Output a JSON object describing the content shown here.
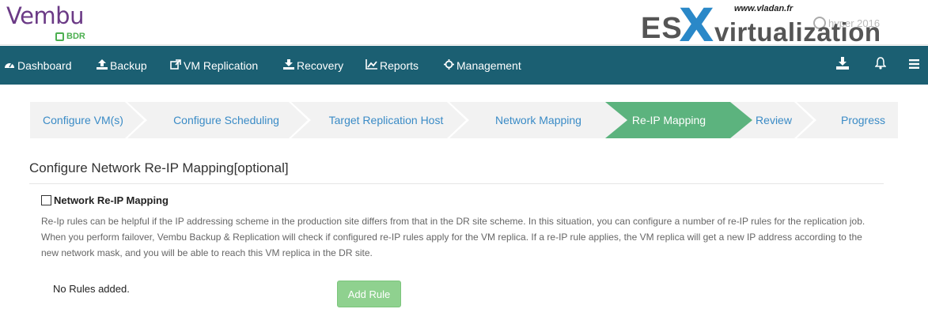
{
  "header": {
    "logo_name": "Vembu",
    "logo_sub": "BDR",
    "brand_url": "www.vladan.fr",
    "brand_es": "ES",
    "brand_x": "X",
    "brand_virt": "virtualization",
    "user_name": "hyper 2016"
  },
  "nav": {
    "items": [
      {
        "label": "Dashboard",
        "icon": "dashboard-icon"
      },
      {
        "label": "Backup",
        "icon": "upload-icon"
      },
      {
        "label": "VM Replication",
        "icon": "replication-icon"
      },
      {
        "label": "Recovery",
        "icon": "download-icon"
      },
      {
        "label": "Reports",
        "icon": "chart-icon"
      },
      {
        "label": "Management",
        "icon": "management-icon"
      }
    ],
    "right_icons": [
      "download-icon",
      "bell-icon",
      "menu-icon"
    ]
  },
  "wizard": {
    "steps": [
      {
        "label": "Configure VM(s)",
        "active": false
      },
      {
        "label": "Configure Scheduling",
        "active": false
      },
      {
        "label": "Target Replication Host",
        "active": false
      },
      {
        "label": "Network Mapping",
        "active": false
      },
      {
        "label": "Re-IP Mapping",
        "active": true
      },
      {
        "label": "Review",
        "active": false
      },
      {
        "label": "Progress",
        "active": false
      }
    ]
  },
  "content": {
    "title": "Configure Network Re-IP Mapping[optional]",
    "checkbox_label": "Network Re-IP Mapping",
    "checkbox_checked": false,
    "description": "Re-Ip rules can be helpful if the IP addressing scheme in the production site differs from that in the DR site scheme. In this situation, you can configure a number of re-IP rules for the replication job. When you perform failover, Vembu Backup & Replication will check if configured re-IP rules apply for the VM replica. If a re-IP rule applies, the VM replica will get a new IP address according to the new network mask, and you will be able to reach this VM replica in the DR site.",
    "no_rules_text": "No Rules added.",
    "add_rule_label": "Add Rule"
  },
  "colors": {
    "nav_bg": "#1b5f72",
    "step_bg": "#f2f2f2",
    "step_active_bg": "#5cb37e",
    "step_text": "#3a8bc6",
    "add_rule_bg": "#8fd18f",
    "logo_purple": "#6b3a86"
  }
}
